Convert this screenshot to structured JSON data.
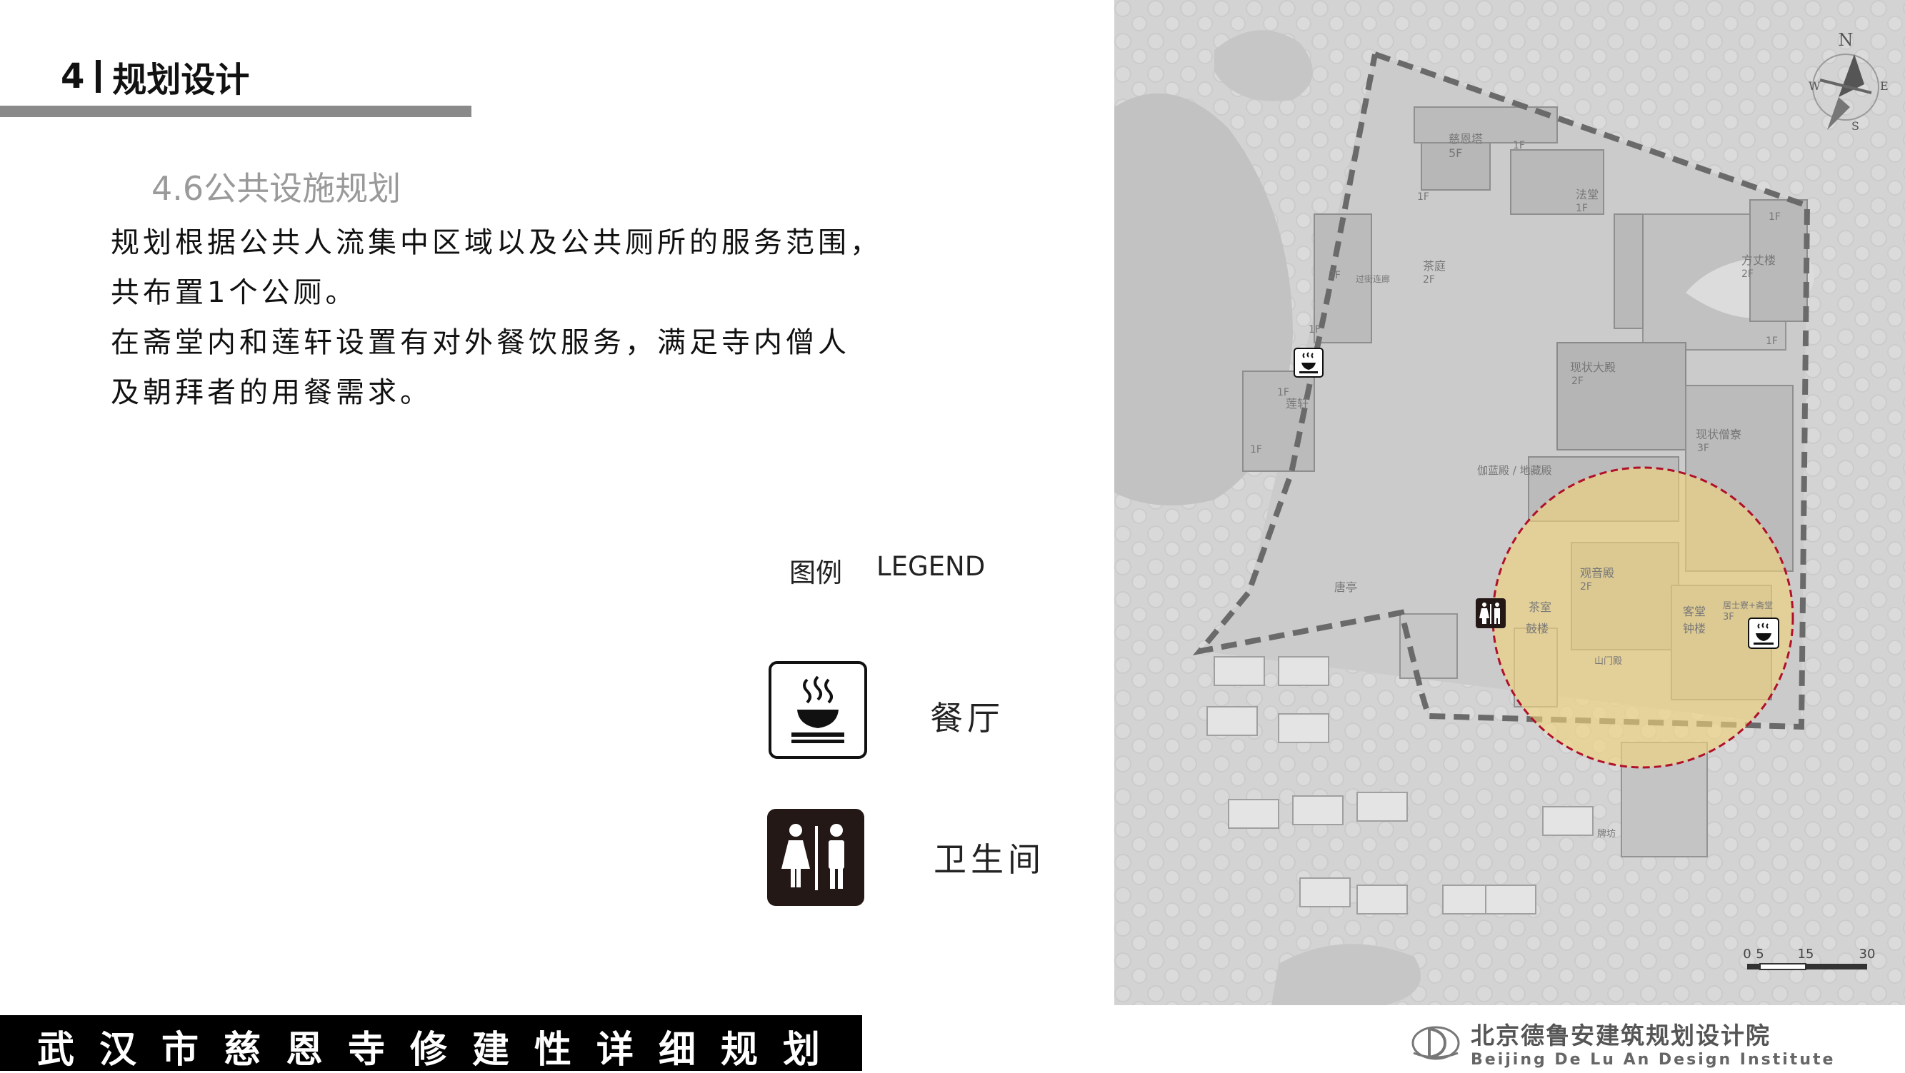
{
  "header": {
    "number": "4",
    "title": "规划设计"
  },
  "section": {
    "title": "4.6公共设施规划",
    "paragraphs": [
      " 规划根据公共人流集中区域以及公共厕所的服务范围，",
      "共布置1个公厕。",
      " 在斋堂内和莲轩设置有对外餐饮服务，满足寺内僧人",
      "及朝拜者的用餐需求。"
    ]
  },
  "legend": {
    "title_cn": "图例",
    "title_en": "LEGEND",
    "items": [
      {
        "icon": "restaurant-icon",
        "label": "餐厅"
      },
      {
        "icon": "restroom-icon",
        "label": "卫生间"
      }
    ]
  },
  "map": {
    "labels": {
      "cientower": "慈恩塔",
      "cientower_floor": "5F",
      "f1a": "1F",
      "f1b": "1F",
      "f1c": "1F",
      "f1d": "1F",
      "f1e": "1F",
      "f1f": "1F",
      "fatang": "法堂",
      "fatang_floor": "1F",
      "fangzhang": "方丈楼",
      "fangzhang_floor": "2F",
      "chating": "茶庭",
      "chating_floor": "2F",
      "corridor": "过街连廊",
      "f2a": "2F",
      "lianxuan_floor": "1F",
      "lianxuan": "莲轩",
      "daidian": "现状大殿",
      "daidian_floor": "2F",
      "sengliao": "现状僧寮",
      "sengliao_floor": "3F",
      "qielan": "伽蓝殿 / 地藏殿",
      "guanyin": "观音殿",
      "guanyin_floor": "2F",
      "tangting": "唐亭",
      "chashi": "茶室",
      "gulou": "鼓楼",
      "shanmen": "山门殿",
      "ketang": "客堂",
      "zhonglou": "钟楼",
      "jushiliao": "居士寮+斋堂",
      "jushiliao_floor": "3F",
      "paifang": "牌坊"
    },
    "compass": {
      "n": "N",
      "e": "E",
      "s": "S",
      "w": "W"
    },
    "scale": {
      "ticks": [
        "0",
        "5",
        "15",
        "30"
      ]
    },
    "colors": {
      "service_area_fill": "#f2d47a",
      "service_area_stroke": "#b0102a",
      "boundary": "#6a6a6a"
    }
  },
  "footer": {
    "title": "武汉市慈恩寺修建性详细规划"
  },
  "institute": {
    "name_cn": "北京德鲁安建筑规划设计院",
    "name_en": "Beijing De Lu An Design Institute"
  }
}
